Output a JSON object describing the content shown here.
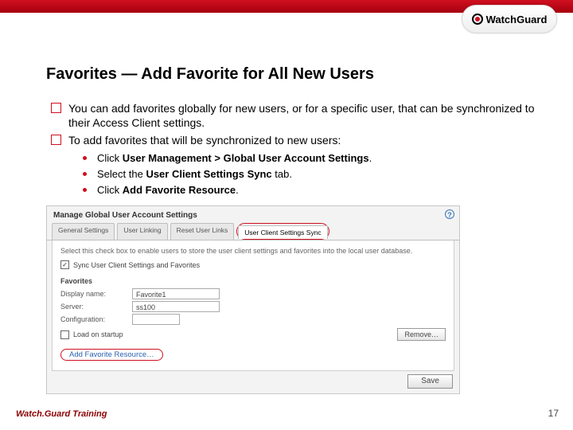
{
  "logo": {
    "prefix": "Watch",
    "suffix": "Guard"
  },
  "title": "Favorites — Add Favorite for All New Users",
  "bullets": {
    "b1": "You can add favorites globally for new users, or for a specific user, that can be synchronized to their Access Client settings.",
    "b2": "To add favorites that will be synchronized to new users:",
    "s1_pre": "Click ",
    "s1_bold": "User Management > Global User Account Settings",
    "s1_post": ".",
    "s2_pre": "Select the ",
    "s2_bold": "User Client Settings Sync",
    "s2_post": " tab.",
    "s3_pre": "Click ",
    "s3_bold": "Add Favorite Resource",
    "s3_post": "."
  },
  "panel": {
    "title": "Manage Global User Account Settings",
    "help": "?",
    "tabs": {
      "t1": "General Settings",
      "t2": "User Linking",
      "t3": "Reset User Links",
      "t4": "User Client Settings Sync"
    },
    "desc": "Select this check box to enable users to store the user client settings and favorites into the local user database.",
    "checkbox_mark": "✓",
    "checkbox_label": "Sync User Client Settings and Favorites",
    "favorites_label": "Favorites",
    "rows": {
      "r1_label": "Display name:",
      "r1_value": "Favorite1",
      "r2_label": "Server:",
      "r2_value": "ss100",
      "r3_label": "Configuration:",
      "r3_value": ""
    },
    "load_label": "Load on startup",
    "remove_btn": "Remove…",
    "add_link": "Add Favorite Resource…",
    "save_btn": "Save"
  },
  "footer": {
    "left": "Watch.Guard Training",
    "page": "17"
  }
}
